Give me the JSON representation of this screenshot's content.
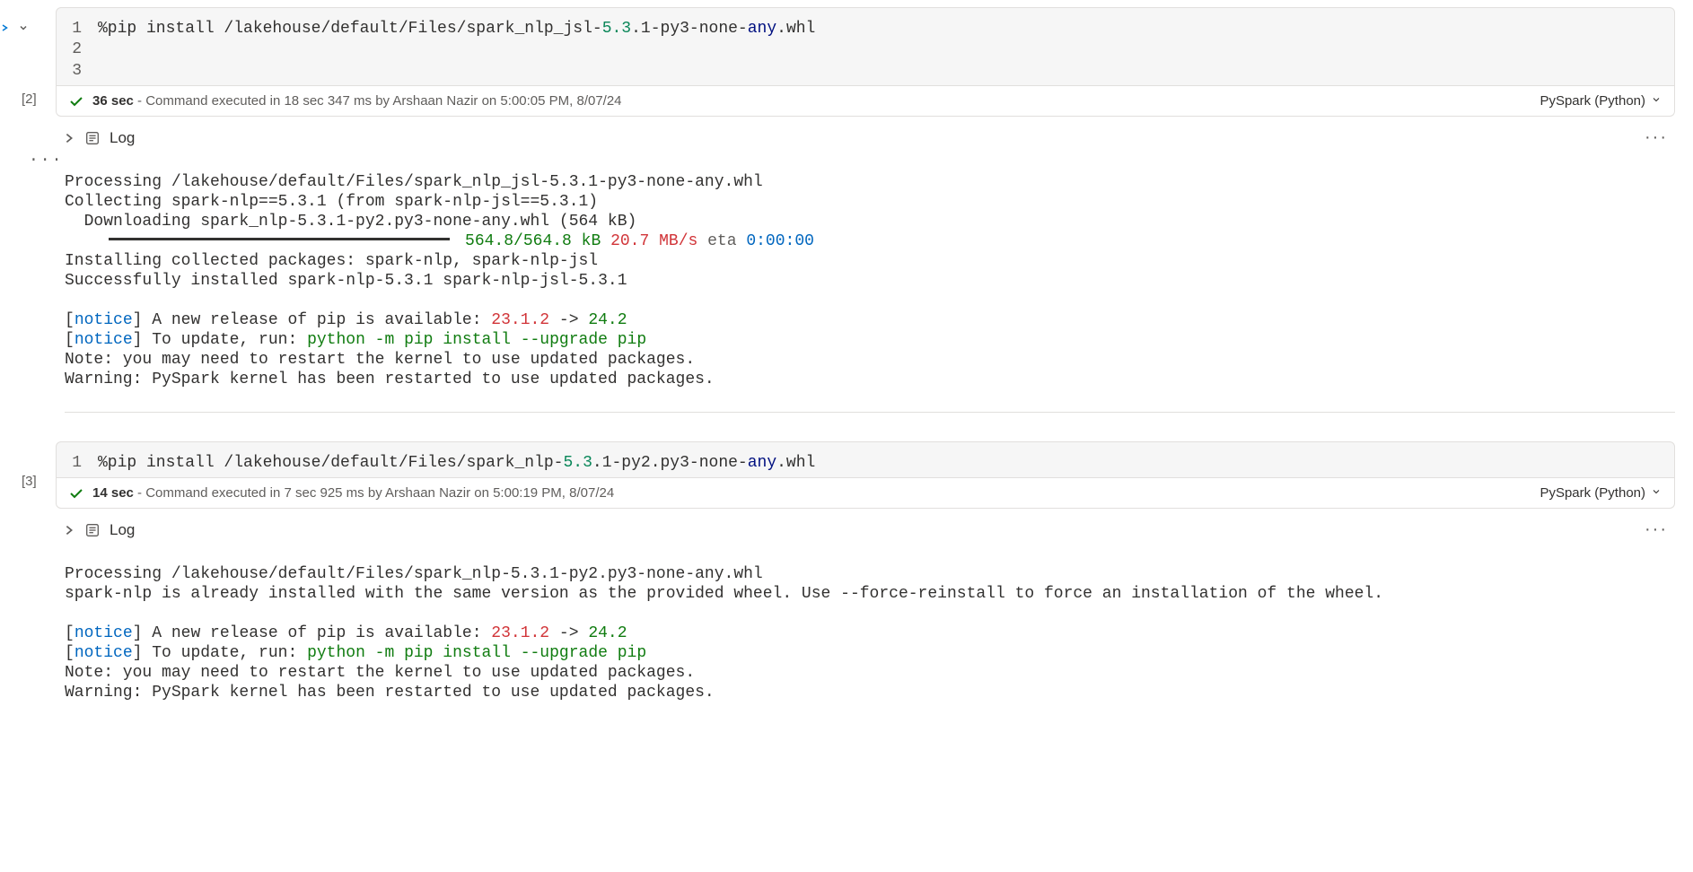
{
  "cell1": {
    "exec_count": "[2]",
    "lines": {
      "l1": "1",
      "l2": "2",
      "l3": "3"
    },
    "code": {
      "prefix": "%pip install /lakehouse/default/Files/spark_nlp_jsl-",
      "ver": "5.3",
      "mid": ".1-py3-none-",
      "any": "any",
      "suffix": ".whl"
    },
    "status": {
      "time": "36 sec",
      "detail": " - Command executed in 18 sec 347 ms by Arshaan Nazir on 5:00:05 PM, 8/07/24"
    },
    "lang": "PySpark (Python)",
    "log_title": "Log",
    "output": {
      "l1": "Processing /lakehouse/default/Files/spark_nlp_jsl-5.3.1-py3-none-any.whl",
      "l2": "Collecting spark-nlp==5.3.1 (from spark-nlp-jsl==5.3.1)",
      "l3": "  Downloading spark_nlp-5.3.1-py2.py3-none-any.whl (564 kB)",
      "prog_size": "564.8/564.8 kB",
      "prog_speed": "20.7 MB/s",
      "prog_eta_lbl": "eta",
      "prog_eta": "0:00:00",
      "l5": "Installing collected packages: spark-nlp, spark-nlp-jsl",
      "l6": "Successfully installed spark-nlp-5.3.1 spark-nlp-jsl-5.3.1",
      "notice_open": "[",
      "notice_word": "notice",
      "notice_close": "] ",
      "n1_a": "A new release of pip is available: ",
      "n1_v1": "23.1.2",
      "n1_arrow": " -> ",
      "n1_v2": "24.2",
      "n2_a": "To update, run: ",
      "n2_cmd": "python -m pip install --upgrade pip",
      "l9": "Note: you may need to restart the kernel to use updated packages.",
      "l10": "Warning: PySpark kernel has been restarted to use updated packages."
    }
  },
  "cell2": {
    "exec_count": "[3]",
    "lines": {
      "l1": "1"
    },
    "code": {
      "prefix": "%pip install /lakehouse/default/Files/spark_nlp-",
      "ver": "5.3",
      "mid": ".1-py2.py3-none-",
      "any": "any",
      "suffix": ".whl"
    },
    "status": {
      "time": "14 sec",
      "detail": " - Command executed in 7 sec 925 ms by Arshaan Nazir on 5:00:19 PM, 8/07/24"
    },
    "lang": "PySpark (Python)",
    "log_title": "Log",
    "output": {
      "l1": "Processing /lakehouse/default/Files/spark_nlp-5.3.1-py2.py3-none-any.whl",
      "l2": "spark-nlp is already installed with the same version as the provided wheel. Use --force-reinstall to force an installation of the wheel.",
      "notice_open": "[",
      "notice_word": "notice",
      "notice_close": "] ",
      "n1_a": "A new release of pip is available: ",
      "n1_v1": "23.1.2",
      "n1_arrow": " -> ",
      "n1_v2": "24.2",
      "n2_a": "To update, run: ",
      "n2_cmd": "python -m pip install --upgrade pip",
      "l5": "Note: you may need to restart the kernel to use updated packages.",
      "l6": "Warning: PySpark kernel has been restarted to use updated packages."
    }
  }
}
